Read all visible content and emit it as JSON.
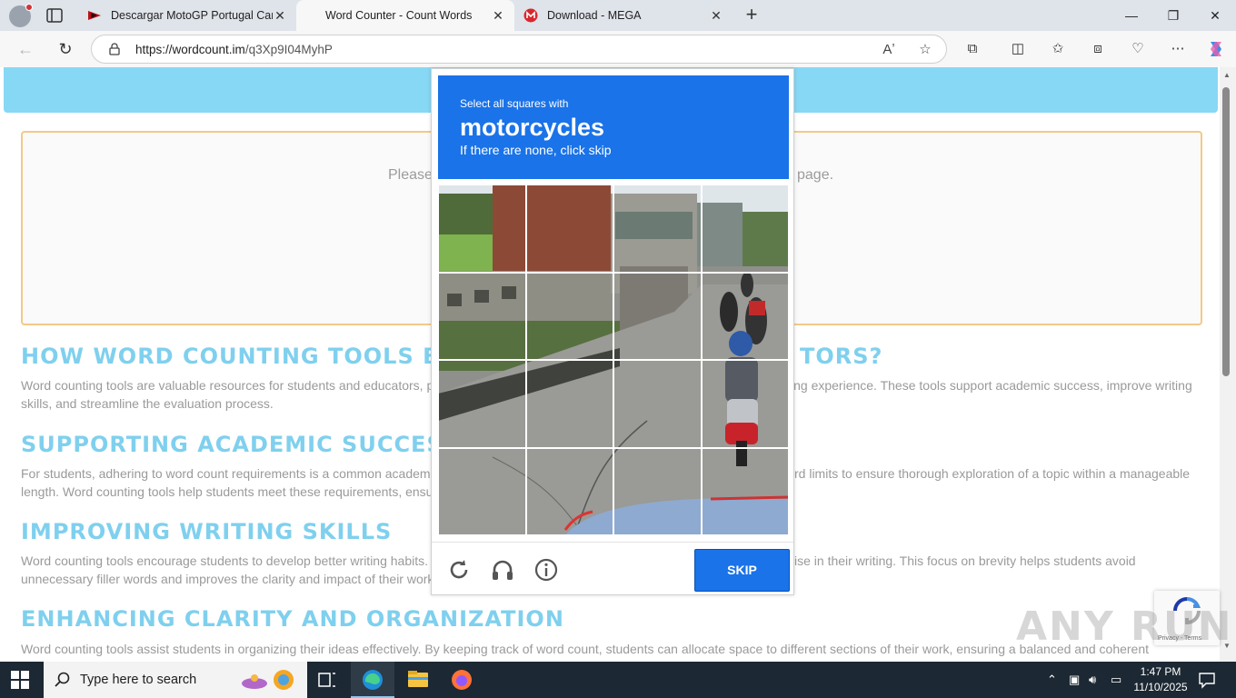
{
  "browser": {
    "tabs": [
      {
        "title": "Descargar MotoGP Portugal Carre",
        "favicon": "motogp-icon",
        "active": false
      },
      {
        "title": "Word Counter - Count Words",
        "favicon": "none",
        "active": true
      },
      {
        "title": "Download - MEGA",
        "favicon": "mega-icon",
        "active": false
      }
    ],
    "url_host": "https://wordcount.im",
    "url_path": "/q3Xp9I04MyhP"
  },
  "page": {
    "placeholder_left": "Please",
    "placeholder_right": "page.",
    "sections": [
      {
        "heading_left": "HOW WORD COUNTING TOOLS BE",
        "heading_right": "TORS?",
        "text_left": "Word counting tools are valuable resources for students and educators, p",
        "text_right": "ing experience. These tools support academic success, improve writing",
        "text_line2": "skills, and streamline the evaluation process."
      },
      {
        "heading_left": "SUPPORTING ACADEMIC SUCCESS",
        "text_left": "For students, adhering to word count requirements is a common academ",
        "text_right": "rd limits to ensure thorough exploration of a topic within a manageable",
        "text_line2": "length. Word counting tools help students meet these requirements, ensu"
      },
      {
        "heading_left": "IMPROVING WRITING SKILLS",
        "text_left": "Word counting tools encourage students to develop better writing habits.",
        "text_right": "ise in their writing. This focus on brevity helps students avoid",
        "text_line2": "unnecessary filler words and improves the clarity and impact of their work"
      },
      {
        "heading_left": "ENHANCING CLARITY AND ORGANIZATION",
        "text_left": "Word counting tools assist students in organizing their ideas effectively. By keeping track of word count, students can allocate space to different sections of their work, ensuring a balanced and coherent"
      }
    ]
  },
  "captcha": {
    "instruction": "Select all squares with",
    "target": "motorcycles",
    "hint": "If there are none, click skip",
    "skip_label": "SKIP",
    "badge_text": "Privacy - Terms"
  },
  "watermark": "ANY RUN",
  "taskbar": {
    "search_placeholder": "Type here to search",
    "time": "1:47 PM",
    "date": "11/10/2025"
  },
  "colors": {
    "accent": "#1a73e8",
    "heading": "#7fd0ee",
    "banner": "#87d8f5",
    "taskbar": "#1c2833"
  }
}
